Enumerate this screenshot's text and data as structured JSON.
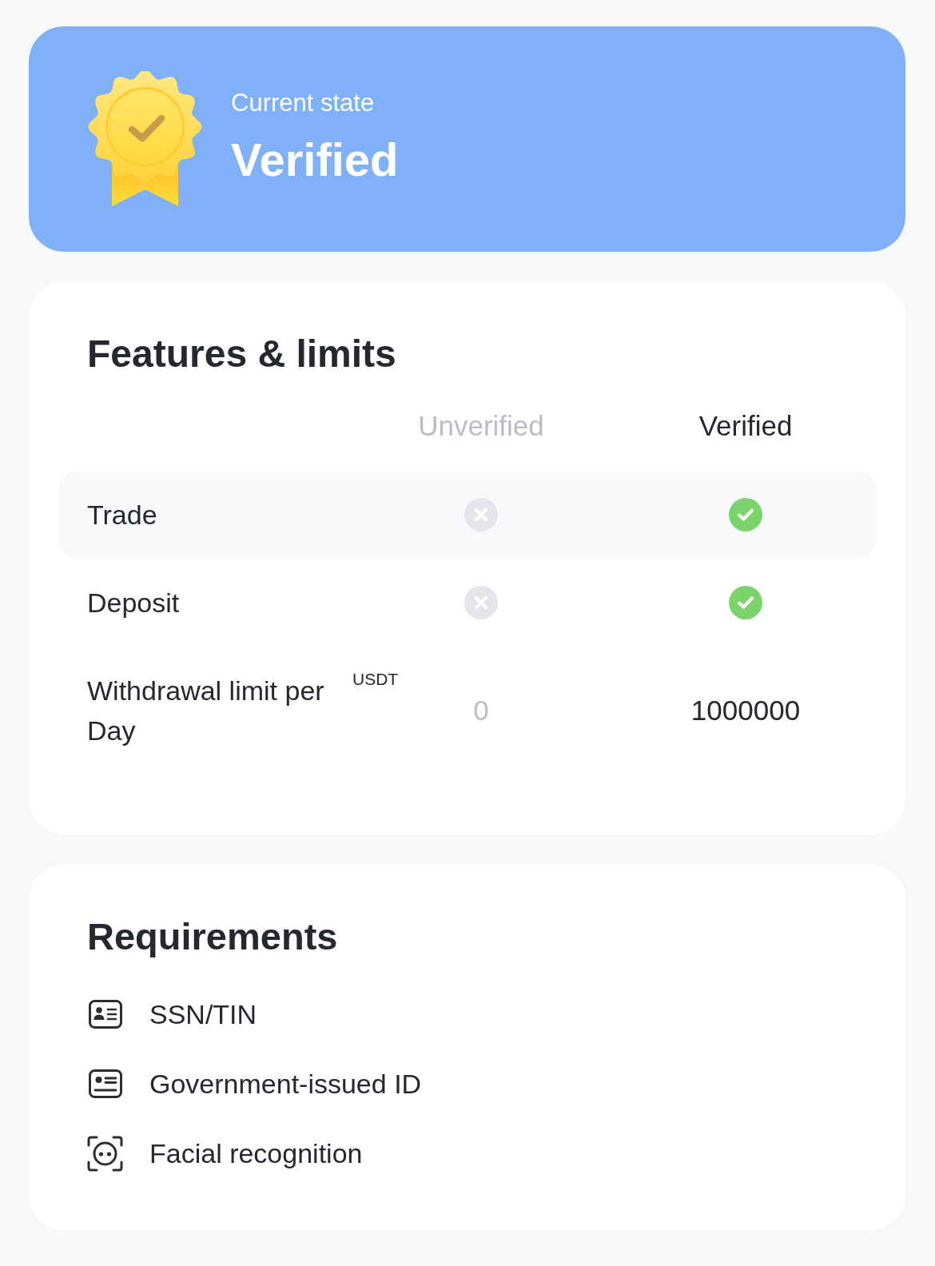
{
  "status_card": {
    "label": "Current state",
    "state": "Verified"
  },
  "features": {
    "title": "Features & limits",
    "columns": [
      {
        "label": "Unverified",
        "current": false
      },
      {
        "label": "Verified",
        "current": true
      }
    ],
    "rows": [
      {
        "kind": "check",
        "label": "Trade",
        "highlighted": true,
        "cells": [
          {
            "allowed": false
          },
          {
            "allowed": true
          }
        ]
      },
      {
        "kind": "check",
        "label": "Deposit",
        "highlighted": false,
        "cells": [
          {
            "allowed": false
          },
          {
            "allowed": true
          }
        ]
      },
      {
        "kind": "amount",
        "label": "Withdrawal limit per Day",
        "unit": "USDT",
        "highlighted": false,
        "cells": [
          {
            "value": "0"
          },
          {
            "value": "1000000"
          }
        ]
      }
    ]
  },
  "requirements": {
    "title": "Requirements",
    "items": [
      {
        "kind": "ssn",
        "label": "SSN/TIN"
      },
      {
        "kind": "id",
        "label": "Government-issued ID"
      },
      {
        "kind": "face",
        "label": "Facial recognition"
      }
    ]
  }
}
